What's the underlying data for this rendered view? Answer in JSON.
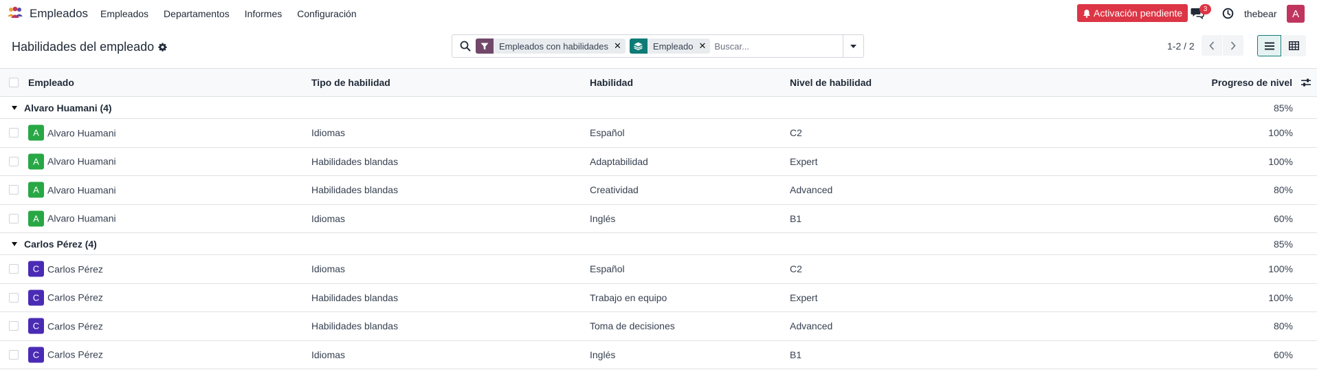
{
  "app": {
    "name": "Empleados",
    "menu": [
      "Empleados",
      "Departamentos",
      "Informes",
      "Configuración"
    ],
    "activation_label": "Activación pendiente",
    "chat_count": "3",
    "username": "thebear",
    "user_initial": "A"
  },
  "control": {
    "title": "Habilidades del empleado",
    "facets": [
      {
        "label": "Empleados con habilidades",
        "icon": "filter-icon"
      },
      {
        "label": "Empleado",
        "icon": "group-by-icon"
      }
    ],
    "search_placeholder": "Buscar...",
    "pager": "1-2 / 2"
  },
  "table": {
    "headers": {
      "employee": "Empleado",
      "type": "Tipo de habilidad",
      "skill": "Habilidad",
      "level": "Nivel de habilidad",
      "progress": "Progreso de nivel"
    },
    "groups": [
      {
        "name": "Alvaro Huamani (4)",
        "progress": "85%",
        "avatar_color": "#28a745",
        "rows": [
          {
            "initial": "A",
            "employee": "Alvaro Huamani",
            "type": "Idiomas",
            "skill": "Español",
            "level": "C2",
            "progress": "100%"
          },
          {
            "initial": "A",
            "employee": "Alvaro Huamani",
            "type": "Habilidades blandas",
            "skill": "Adaptabilidad",
            "level": "Expert",
            "progress": "100%"
          },
          {
            "initial": "A",
            "employee": "Alvaro Huamani",
            "type": "Habilidades blandas",
            "skill": "Creatividad",
            "level": "Advanced",
            "progress": "80%"
          },
          {
            "initial": "A",
            "employee": "Alvaro Huamani",
            "type": "Idiomas",
            "skill": "Inglés",
            "level": "B1",
            "progress": "60%"
          }
        ]
      },
      {
        "name": "Carlos Pérez (4)",
        "progress": "85%",
        "avatar_color": "#4a2bb5",
        "rows": [
          {
            "initial": "C",
            "employee": "Carlos Pérez",
            "type": "Idiomas",
            "skill": "Español",
            "level": "C2",
            "progress": "100%"
          },
          {
            "initial": "C",
            "employee": "Carlos Pérez",
            "type": "Habilidades blandas",
            "skill": "Trabajo en equipo",
            "level": "Expert",
            "progress": "100%"
          },
          {
            "initial": "C",
            "employee": "Carlos Pérez",
            "type": "Habilidades blandas",
            "skill": "Toma de decisiones",
            "level": "Advanced",
            "progress": "80%"
          },
          {
            "initial": "C",
            "employee": "Carlos Pérez",
            "type": "Idiomas",
            "skill": "Inglés",
            "level": "B1",
            "progress": "60%"
          }
        ]
      }
    ]
  }
}
